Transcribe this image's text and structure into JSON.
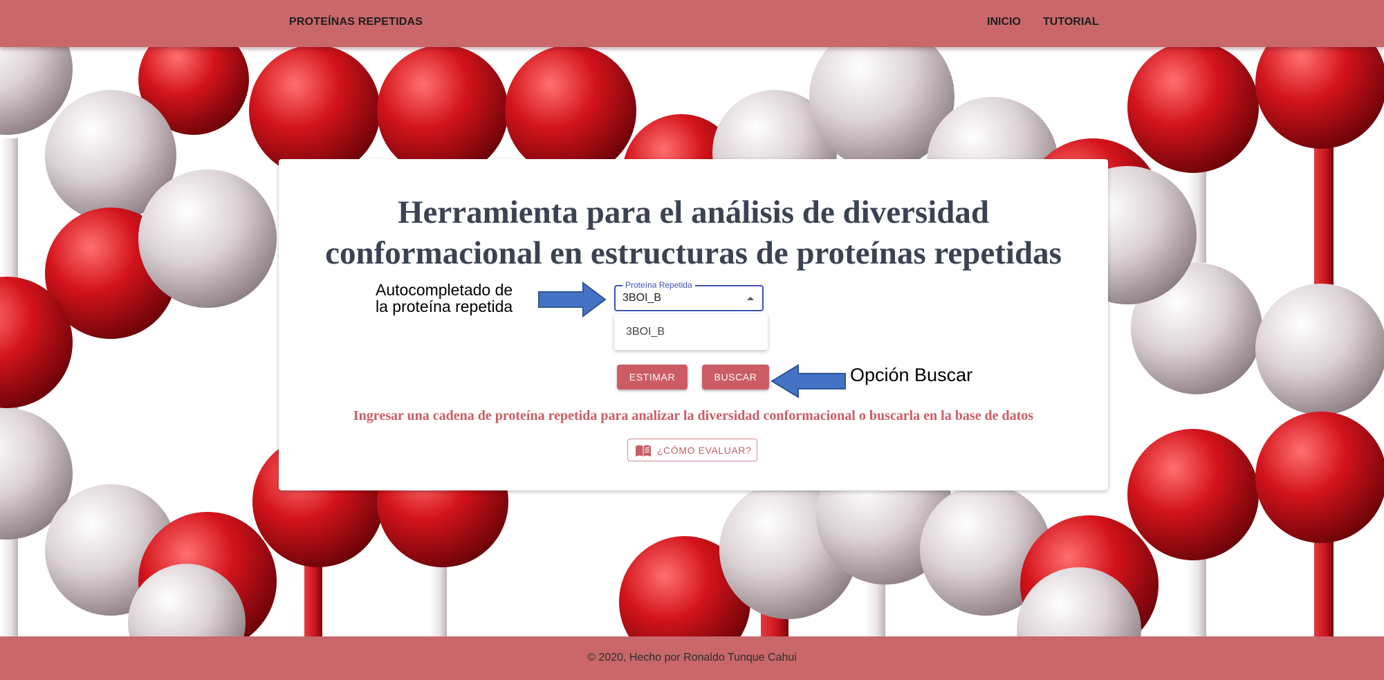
{
  "header": {
    "brand": "PROTEÍNAS REPETIDAS",
    "nav": [
      "INICIO",
      "TUTORIAL"
    ]
  },
  "main": {
    "title_line1": "Herramienta para el análisis de diversidad",
    "title_line2": "conformacional en estructuras de proteínas repetidas",
    "autocomplete": {
      "label": "Proteína Repetida",
      "value": "3BOI_B",
      "options": [
        "3BOI_B"
      ]
    },
    "buttons": {
      "estimar": "ESTIMAR",
      "buscar": "BUSCAR"
    },
    "instruction": "Ingresar una cadena de proteína repetida para analizar la diversidad conformacional o buscarla en la base de datos",
    "help_button": "¿CÓMO EVALUAR?"
  },
  "annotations": {
    "autocomplete_line1": "Autocompletado de",
    "autocomplete_line2": "la proteína repetida",
    "search_option": "Opción Buscar"
  },
  "footer": {
    "text": "© 2020, Hecho por Ronaldo Tunque Cahui"
  },
  "colors": {
    "bar": "#c9676a",
    "button": "#cc5c64",
    "title": "#3b4252",
    "field_focus": "#3f51b5",
    "arrow": "#4472c4",
    "sphere_red": "#c8141e",
    "sphere_white": "#d8cfd2"
  },
  "icons": {
    "help_button_icon": "open-book-icon",
    "autocomplete_caret": "caret-up-icon"
  }
}
